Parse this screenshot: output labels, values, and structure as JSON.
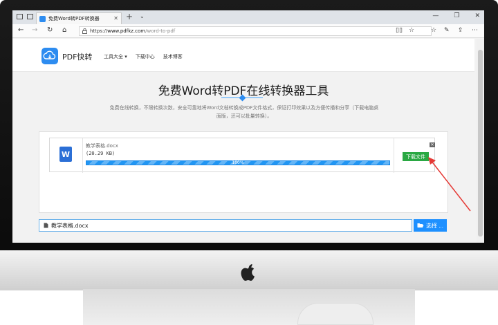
{
  "browser": {
    "tab_title": "免费Word转PDF转换器",
    "tab_close": "✕",
    "new_tab": "+",
    "tab_menu": "⌄",
    "url_scheme": "https://",
    "url_host": "www.pdfkz.com",
    "url_path": "/word-to-pdf",
    "back": "←",
    "forward": "→",
    "refresh": "↻",
    "home": "⌂",
    "minimize": "—",
    "maximize": "❐",
    "close": "✕"
  },
  "site": {
    "logo_text": "PDF快转",
    "menu": [
      "工具大全 ▾",
      "下载中心",
      "技术博客"
    ]
  },
  "page": {
    "title": "免费Word转PDF在线转换器工具",
    "description": "免费在线转换，不限转换次数，安全可靠地将Word文档转换成PDF文件格式，保证打印效果以及方便传播和分享（下载电脑桌面版，还可以批量转换）。"
  },
  "file": {
    "icon_letter": "W",
    "name": "教学表格.docx",
    "size": "(20.29 KB)",
    "progress_text": "100%",
    "progress": 1.0,
    "download_label": "下载文件",
    "remove_label": "✕"
  },
  "file_input": {
    "value": "教学表格.docx",
    "choose_label": "选择 ..."
  },
  "colors": {
    "accent": "#2d8cf0",
    "download_green": "#2aa843",
    "arrow_red": "#e53935"
  }
}
